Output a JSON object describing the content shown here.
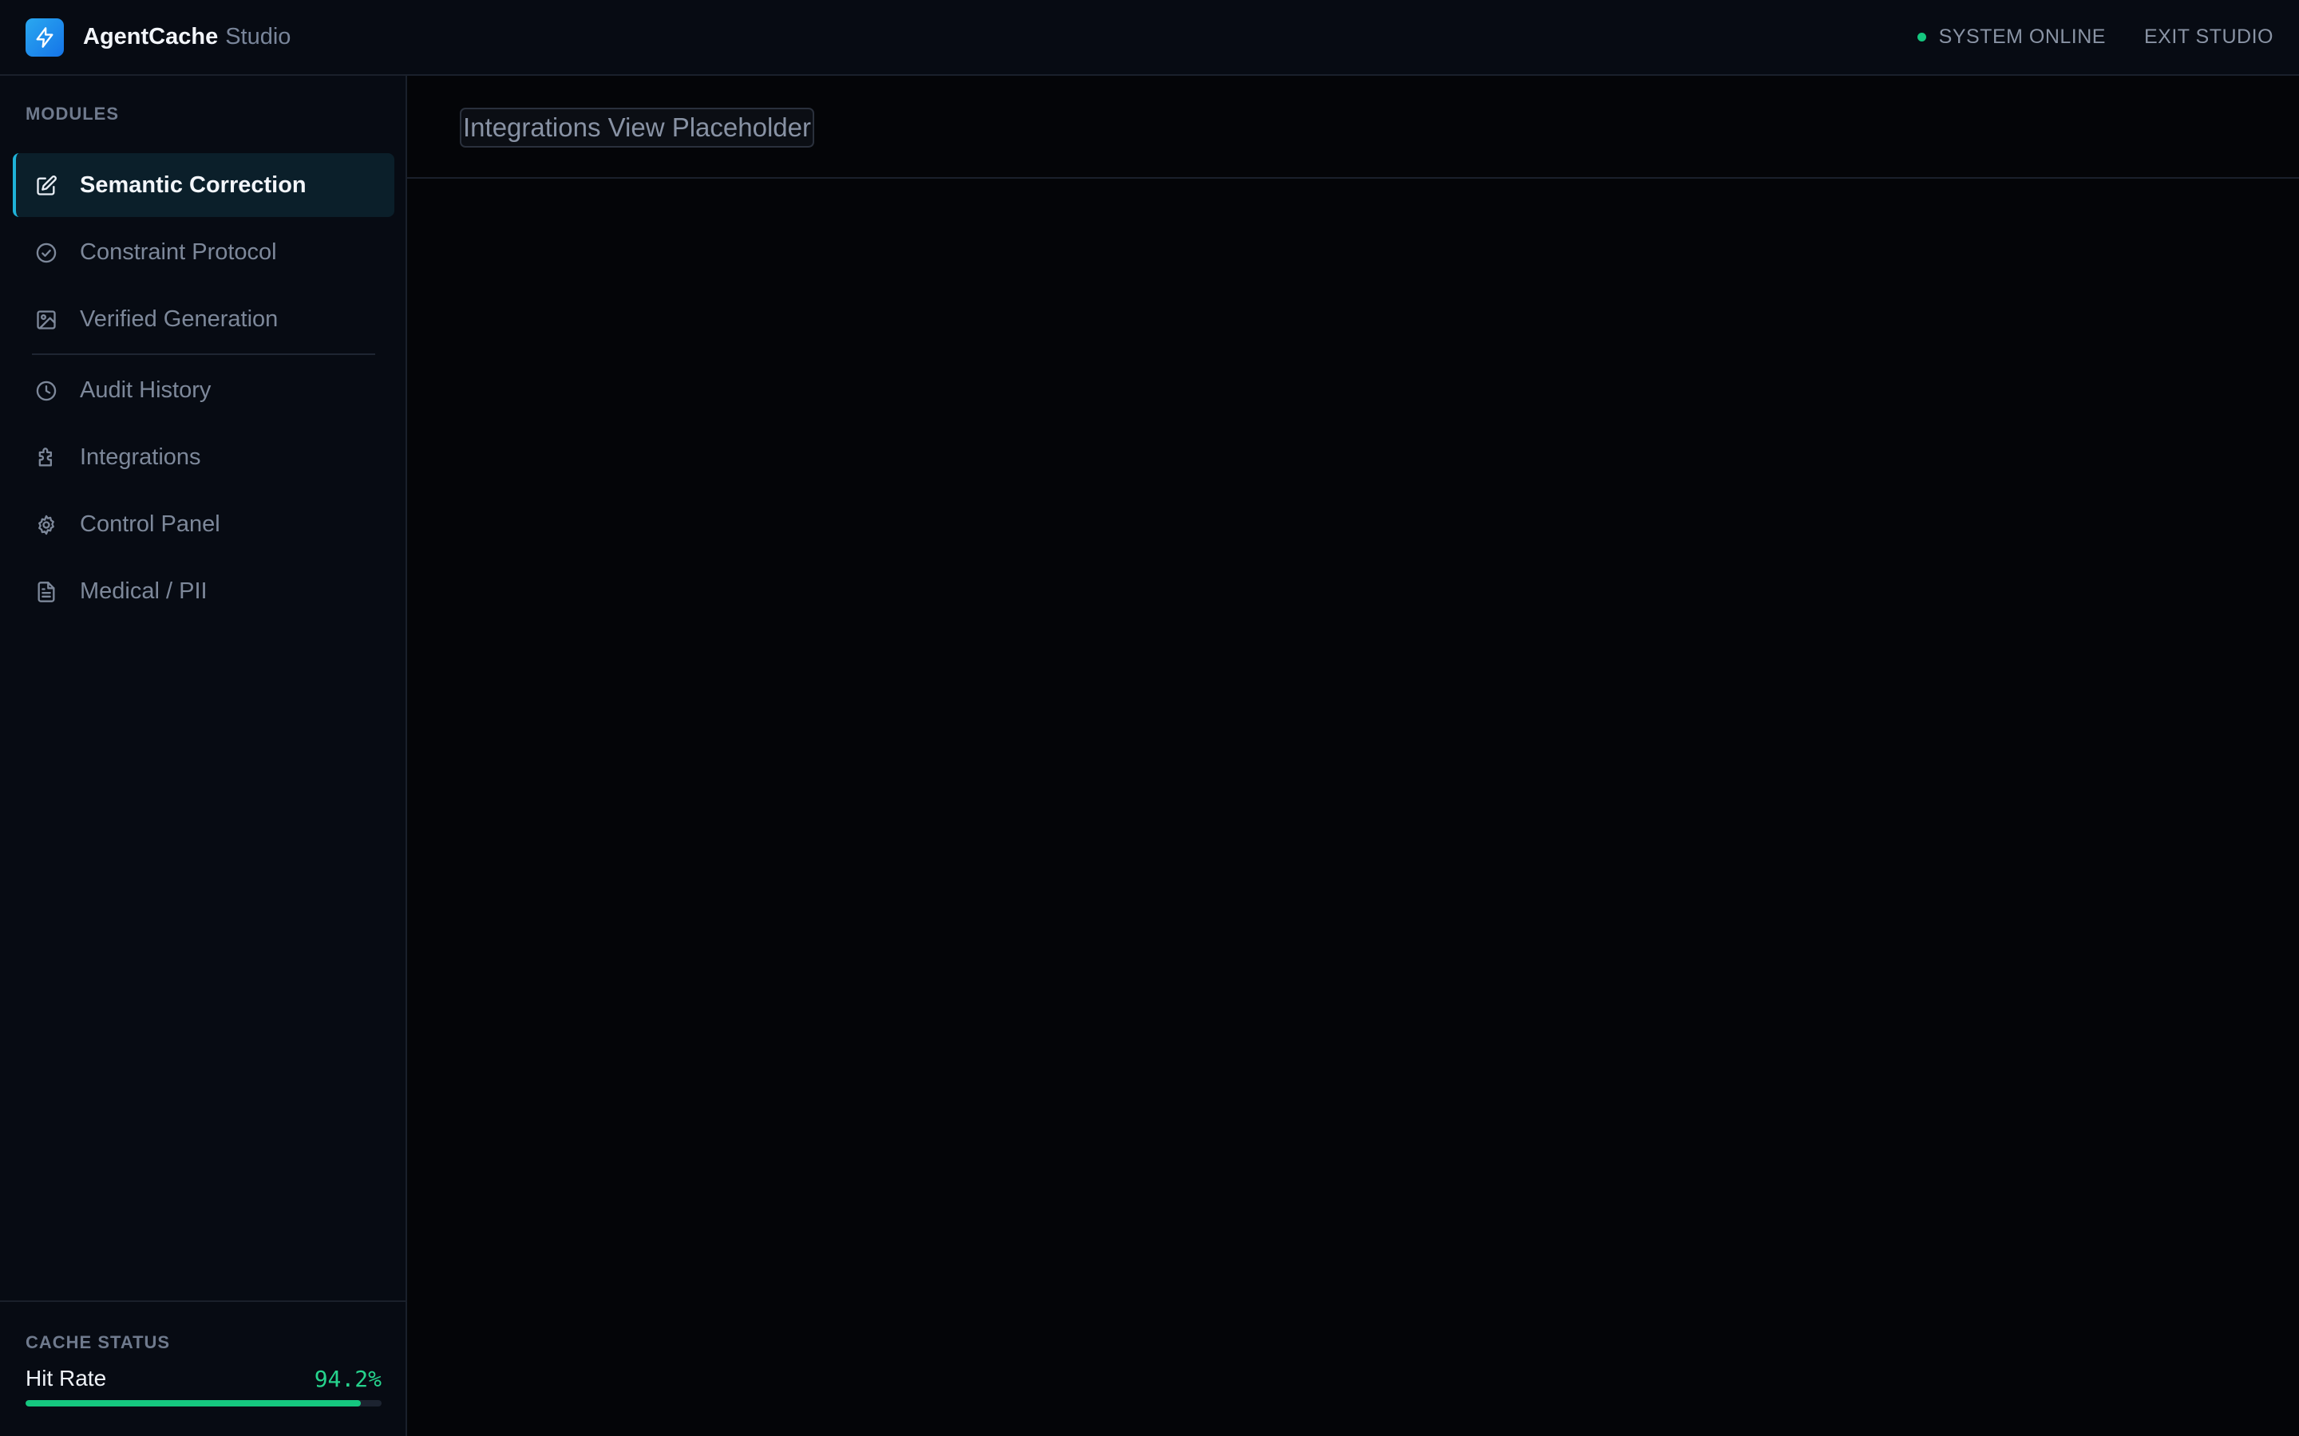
{
  "header": {
    "brand_name": "AgentCache",
    "brand_sub": "Studio",
    "status_text": "SYSTEM ONLINE",
    "exit_label": "EXIT STUDIO"
  },
  "sidebar": {
    "section_label": "MODULES",
    "items": [
      {
        "label": "Semantic Correction",
        "icon": "edit-icon",
        "active": true
      },
      {
        "label": "Constraint Protocol",
        "icon": "check-circle-icon",
        "active": false
      },
      {
        "label": "Verified Generation",
        "icon": "image-icon",
        "active": false
      },
      {
        "label": "Audit History",
        "icon": "clock-icon",
        "active": false
      },
      {
        "label": "Integrations",
        "icon": "puzzle-icon",
        "active": false
      },
      {
        "label": "Control Panel",
        "icon": "gear-icon",
        "active": false
      },
      {
        "label": "Medical / PII",
        "icon": "document-icon",
        "active": false
      }
    ],
    "cache": {
      "label": "CACHE STATUS",
      "hit_rate_label": "Hit Rate",
      "hit_rate_value": "94.2%",
      "hit_rate_fraction": 0.942
    }
  },
  "main": {
    "placeholder_text": "Integrations View Placeholder"
  },
  "colors": {
    "accent": "#1fb2d8",
    "success": "#15c77f",
    "logo_gradient_start": "#2aa8f0",
    "logo_gradient_end": "#1574e8"
  }
}
